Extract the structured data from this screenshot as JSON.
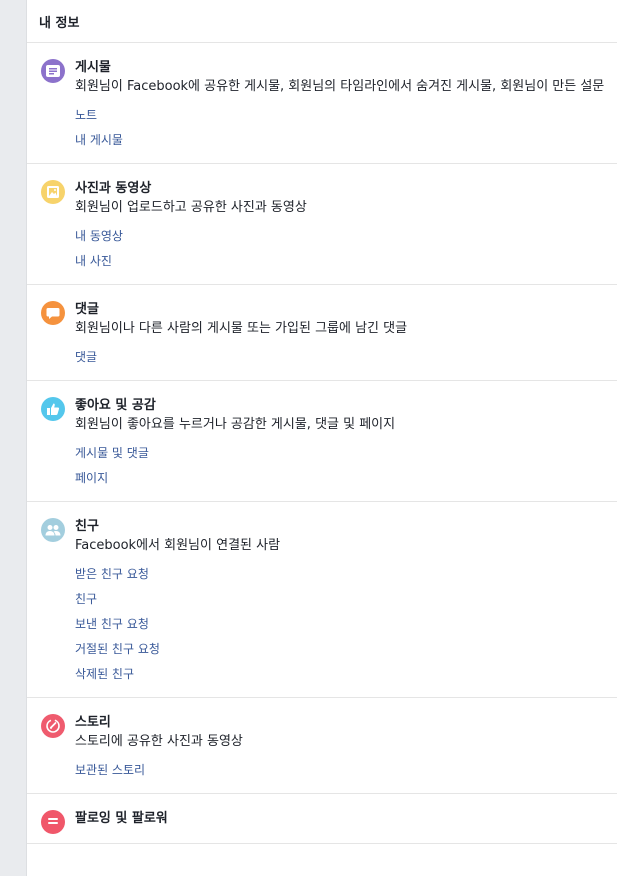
{
  "panel": {
    "title": "내 정보"
  },
  "sections": [
    {
      "title": "게시물",
      "icon": "posts-icon",
      "description": "회원님이 Facebook에 공유한 게시물, 회원님의 타임라인에서 숨겨진 게시물, 회원님이 만든 설문",
      "links": [
        "노트",
        "내 게시물"
      ],
      "color": "#8c72cb"
    },
    {
      "title": "사진과 동영상",
      "icon": "photos-icon",
      "description": "회원님이 업로드하고 공유한 사진과 동영상",
      "links": [
        "내 동영상",
        "내 사진"
      ],
      "color": "#f7d36b"
    },
    {
      "title": "댓글",
      "icon": "comment-icon",
      "description": "회원님이나 다른 사람의 게시물 또는 가입된 그룹에 남긴 댓글",
      "links": [
        "댓글"
      ],
      "color": "#f5923e"
    },
    {
      "title": "좋아요 및 공감",
      "icon": "like-icon",
      "description": "회원님이 좋아요를 누르거나 공감한 게시물, 댓글 및 페이지",
      "links": [
        "게시물 및 댓글",
        "페이지"
      ],
      "color": "#54c7ec"
    },
    {
      "title": "친구",
      "icon": "friends-icon",
      "description": "Facebook에서 회원님이 연결된 사람",
      "links": [
        "받은 친구 요청",
        "친구",
        "보낸 친구 요청",
        "거절된 친구 요청",
        "삭제된 친구"
      ],
      "color": "#a3cede"
    },
    {
      "title": "스토리",
      "icon": "stories-icon",
      "description": "스토리에 공유한 사진과 동영상",
      "links": [
        "보관된 스토리"
      ],
      "color": "#ef5b6e"
    },
    {
      "title": "팔로잉 및 팔로워",
      "icon": "following-icon",
      "description": "",
      "links": [],
      "color": "#f0576a"
    }
  ]
}
